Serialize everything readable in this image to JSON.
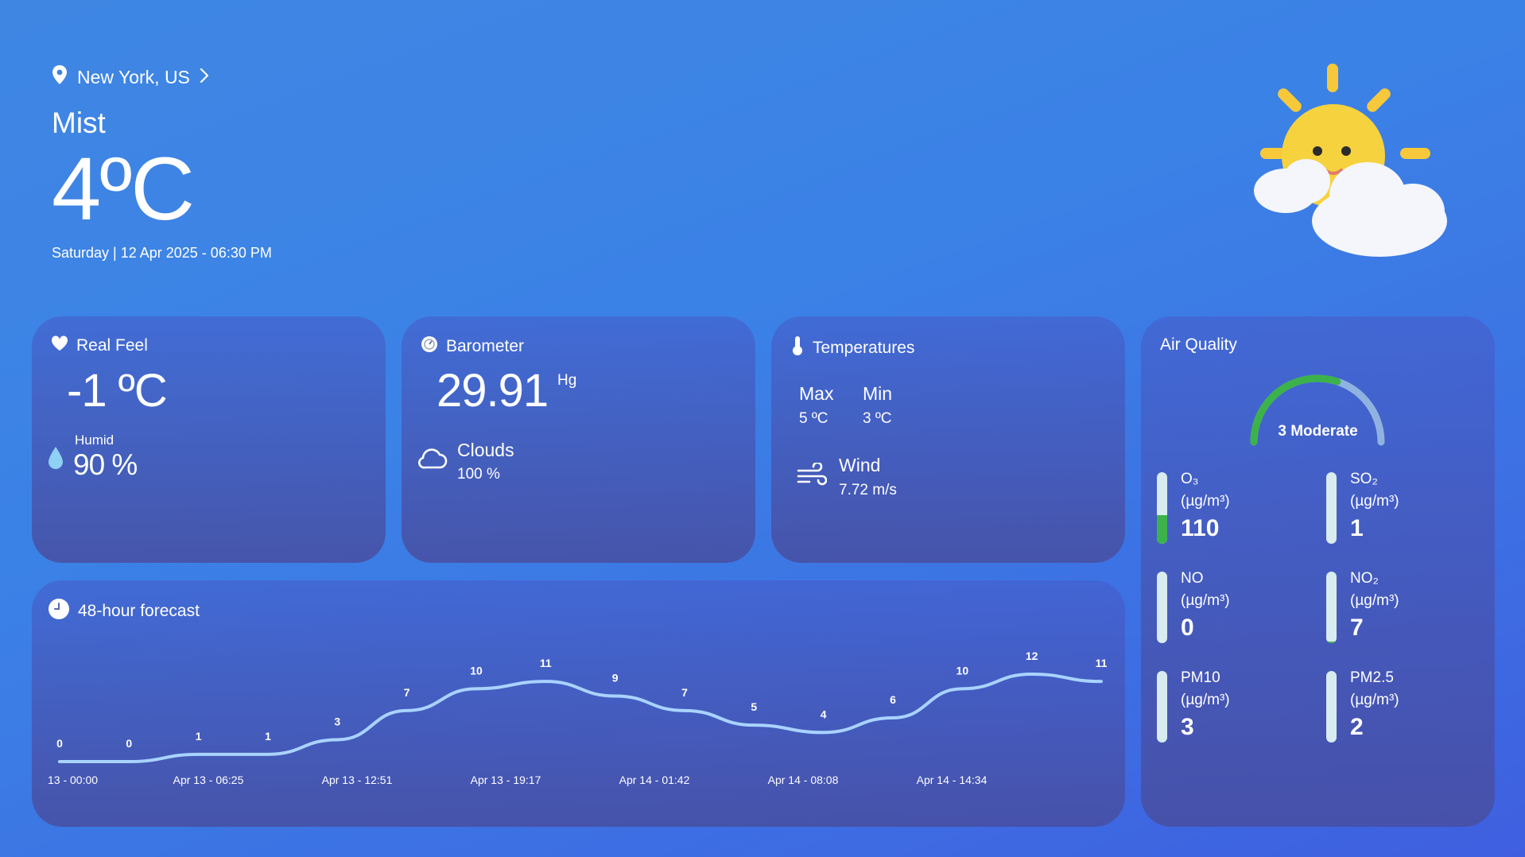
{
  "header": {
    "location": "New York, US",
    "condition": "Mist",
    "temperature": "4ºC",
    "date": "Saturday | 12 Apr 2025 - 06:30 PM"
  },
  "real_feel": {
    "title": "Real Feel",
    "value": "-1 ºC",
    "humid_label": "Humid",
    "humid_value": "90 %"
  },
  "barometer": {
    "title": "Barometer",
    "value": "29.91",
    "unit": "Hg",
    "clouds_label": "Clouds",
    "clouds_value": "100 %"
  },
  "temperatures": {
    "title": "Temperatures",
    "max_label": "Max",
    "max_value": "5 ºC",
    "min_label": "Min",
    "min_value": "3 ºC",
    "wind_label": "Wind",
    "wind_value": "7.72 m/s"
  },
  "air_quality": {
    "title": "Air Quality",
    "index_label": "3 Moderate",
    "index_fraction": 0.6,
    "items": [
      {
        "name": "O₃",
        "unit": "(µg/m³)",
        "value": "110",
        "level": 0.4
      },
      {
        "name": "SO₂",
        "unit": "(µg/m³)",
        "value": "1",
        "level": 0.0
      },
      {
        "name": "NO",
        "unit": "(µg/m³)",
        "value": "0",
        "level": 0.0
      },
      {
        "name": "NO₂",
        "unit": "(µg/m³)",
        "value": "7",
        "level": 0.02
      },
      {
        "name": "PM10",
        "unit": "(µg/m³)",
        "value": "3",
        "level": 0.0
      },
      {
        "name": "PM2.5",
        "unit": "(µg/m³)",
        "value": "2",
        "level": 0.0
      }
    ],
    "colors": {
      "fill": "#3bb34a",
      "track": "#d8ecef",
      "gauge_rest": "#8fb2e0"
    }
  },
  "forecast": {
    "title": "48-hour forecast"
  },
  "chart_data": {
    "type": "line",
    "x": [
      0,
      1,
      2,
      3,
      4,
      5,
      6,
      7,
      8,
      9,
      10,
      11,
      12,
      13,
      14,
      15
    ],
    "values": [
      0,
      0,
      1,
      1,
      3,
      7,
      10,
      11,
      9,
      7,
      5,
      4,
      6,
      10,
      12,
      11
    ],
    "tick_labels": [
      "13 - 00:00",
      "Apr 13 - 06:25",
      "Apr 13 - 12:51",
      "Apr 13 - 19:17",
      "Apr 14 - 01:42",
      "Apr 14 - 08:08",
      "Apr 14 - 14:34"
    ],
    "line_color": "#a9d3ff",
    "ylim": [
      0,
      12
    ]
  }
}
